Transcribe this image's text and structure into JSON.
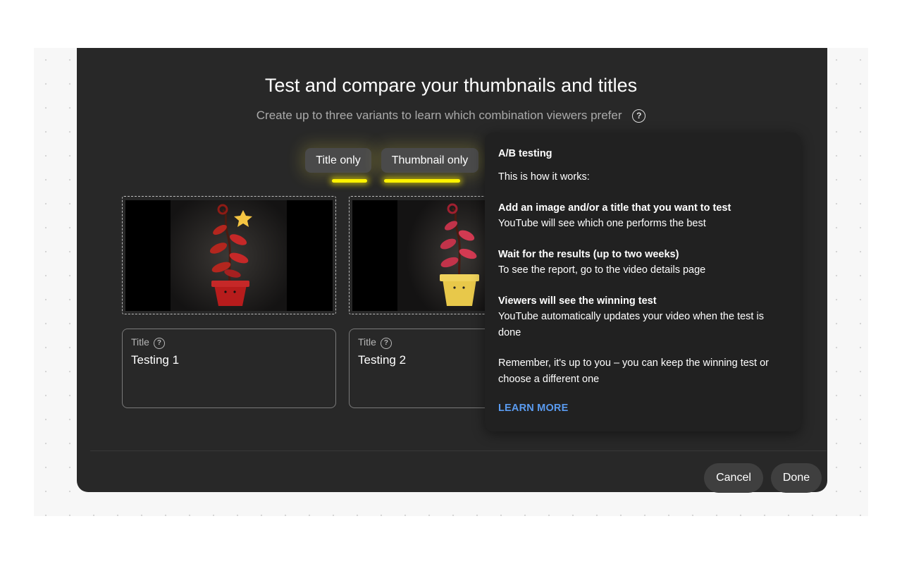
{
  "dialog": {
    "title": "Test and compare your thumbnails and titles",
    "subtitle": "Create up to three variants to learn which combination viewers prefer",
    "help_icon": "question-circle-icon"
  },
  "tabs": [
    {
      "label": "Title only"
    },
    {
      "label": "Thumbnail only"
    }
  ],
  "variants": [
    {
      "title_label": "Title",
      "title_value": "Testing 1",
      "pot_color": "#b71c1c"
    },
    {
      "title_label": "Title",
      "title_value": "Testing 2",
      "pot_color": "#e8c84a"
    }
  ],
  "tooltip": {
    "heading": "A/B testing",
    "intro": "This is how it works:",
    "steps": [
      {
        "title": "Add an image and/or a title that you want to test",
        "body": "YouTube will see which one performs the best"
      },
      {
        "title": "Wait for the results (up to two weeks)",
        "body": "To see the report, go to the video details page"
      },
      {
        "title": "Viewers will see the winning test",
        "body": "YouTube automatically updates your video when the test is done"
      }
    ],
    "note": "Remember, it's up to you – you can keep the winning test or choose a different one",
    "link": "LEARN MORE"
  },
  "footer": {
    "cancel": "Cancel",
    "done": "Done"
  },
  "colors": {
    "dialog_bg": "#282828",
    "highlight": "#fff200",
    "link": "#5a9bf0"
  }
}
